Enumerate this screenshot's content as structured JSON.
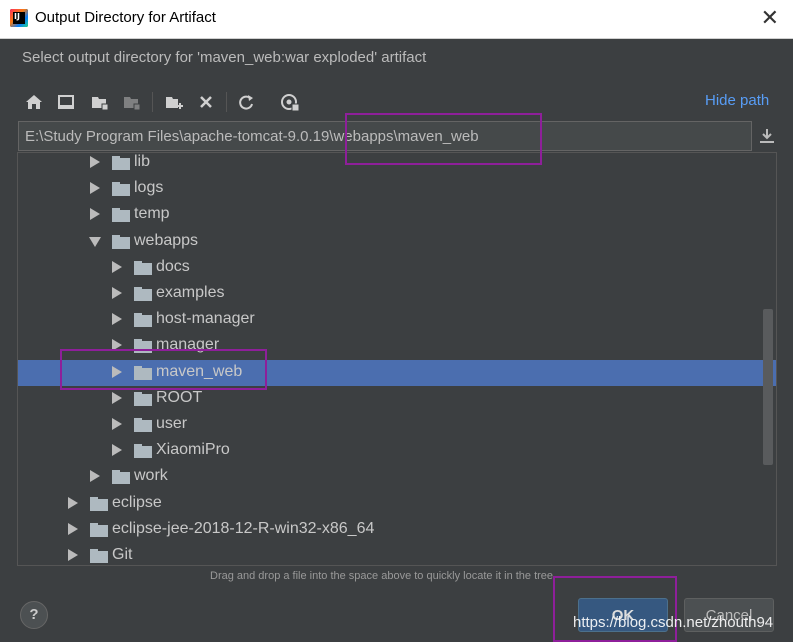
{
  "window": {
    "title": "Output Directory for Artifact",
    "close_glyph": "✕"
  },
  "subtitle": "Select output directory for 'maven_web:war exploded' artifact",
  "toolbar": {
    "icons": [
      "home-icon",
      "desktop-icon",
      "project-folder-icon",
      "module-folder-icon",
      "new-folder-icon",
      "delete-icon",
      "refresh-icon",
      "show-hidden-icon"
    ],
    "hide_path_label": "Hide path"
  },
  "path": {
    "value": "E:\\Study Program Files\\apache-tomcat-9.0.19\\webapps\\maven_web"
  },
  "tree": {
    "rows": [
      {
        "label": "lib",
        "expanded": false,
        "depth": 3
      },
      {
        "label": "logs",
        "expanded": false,
        "depth": 3
      },
      {
        "label": "temp",
        "expanded": false,
        "depth": 3
      },
      {
        "label": "webapps",
        "expanded": true,
        "depth": 3
      },
      {
        "label": "docs",
        "expanded": false,
        "depth": 4
      },
      {
        "label": "examples",
        "expanded": false,
        "depth": 4
      },
      {
        "label": "host-manager",
        "expanded": false,
        "depth": 4
      },
      {
        "label": "manager",
        "expanded": false,
        "depth": 4
      },
      {
        "label": "maven_web",
        "expanded": false,
        "depth": 4,
        "selected": true
      },
      {
        "label": "ROOT",
        "expanded": false,
        "depth": 4
      },
      {
        "label": "user",
        "expanded": false,
        "depth": 4
      },
      {
        "label": "XiaomiPro",
        "expanded": false,
        "depth": 4
      },
      {
        "label": "work",
        "expanded": false,
        "depth": 3
      },
      {
        "label": "eclipse",
        "expanded": false,
        "depth": 2
      },
      {
        "label": "eclipse-jee-2018-12-R-win32-x86_64",
        "expanded": false,
        "depth": 2
      },
      {
        "label": "Git",
        "expanded": false,
        "depth": 2
      }
    ]
  },
  "hint": "Drag and drop a file into the space above to quickly locate it in the tree",
  "buttons": {
    "help": "?",
    "ok": "OK",
    "cancel": "Cancel"
  },
  "watermark": "https://blog.csdn.net/zhouth94",
  "colors": {
    "selection": "#4b6eaf",
    "link": "#589df6",
    "annotation": "#8e1f9a",
    "background": "#3c3f41"
  }
}
